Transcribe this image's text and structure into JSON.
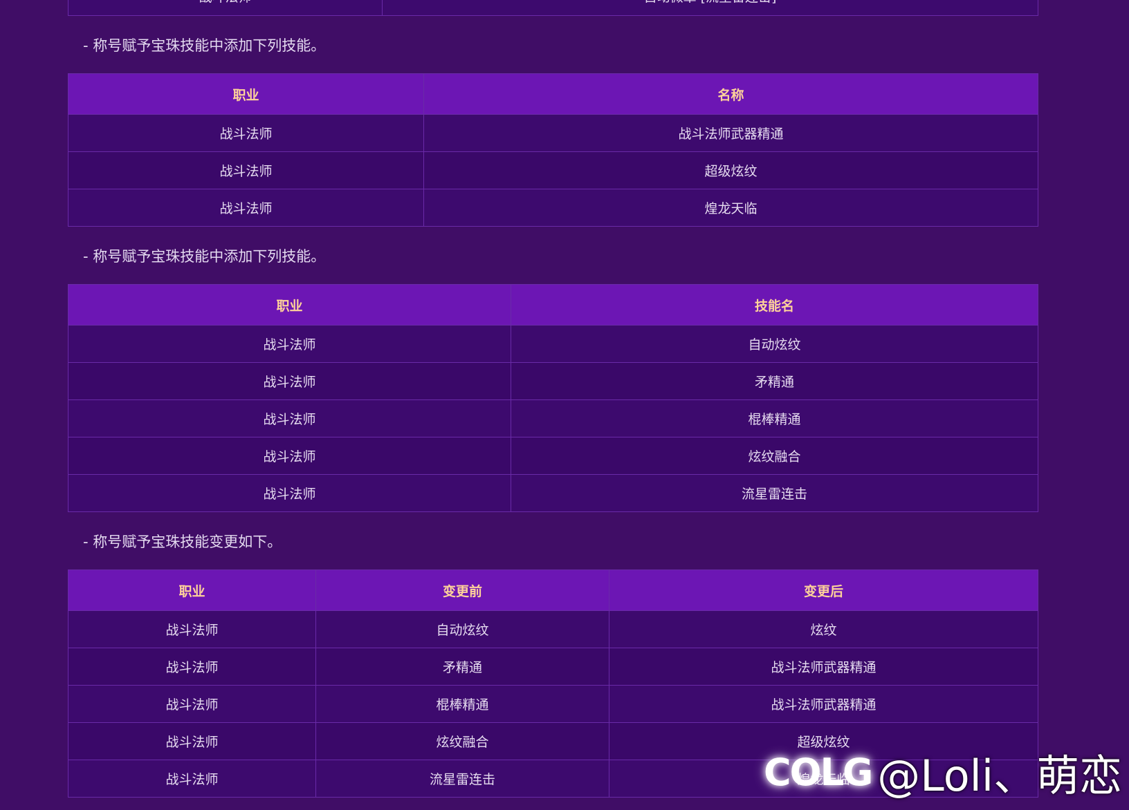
{
  "previous_table_row": [
    "战斗法师",
    "自动微章 [流星雷连击]"
  ],
  "sections": [
    {
      "note": "- 称号赋予宝珠技能中添加下列技能。",
      "headers": [
        "职业",
        "名称"
      ],
      "rows": [
        [
          "战斗法师",
          "战斗法师武器精通"
        ],
        [
          "战斗法师",
          "超级炫纹"
        ],
        [
          "战斗法师",
          "煌龙天临"
        ]
      ]
    },
    {
      "note": "- 称号赋予宝珠技能中添加下列技能。",
      "headers": [
        "职业",
        "技能名"
      ],
      "rows": [
        [
          "战斗法师",
          "自动炫纹"
        ],
        [
          "战斗法师",
          "矛精通"
        ],
        [
          "战斗法师",
          "棍棒精通"
        ],
        [
          "战斗法师",
          "炫纹融合"
        ],
        [
          "战斗法师",
          "流星雷连击"
        ]
      ]
    },
    {
      "note": "- 称号赋予宝珠技能变更如下。",
      "headers": [
        "职业",
        "变更前",
        "变更后"
      ],
      "rows": [
        [
          "战斗法师",
          "自动炫纹",
          "炫纹"
        ],
        [
          "战斗法师",
          "矛精通",
          "战斗法师武器精通"
        ],
        [
          "战斗法师",
          "棍棒精通",
          "战斗法师武器精通"
        ],
        [
          "战斗法师",
          "炫纹融合",
          "超级炫纹"
        ],
        [
          "战斗法师",
          "流星雷连击",
          "煌龙天临"
        ]
      ]
    }
  ],
  "watermark": {
    "logo": "COLG",
    "handle": "@Loli、萌恋"
  }
}
